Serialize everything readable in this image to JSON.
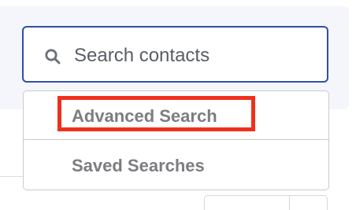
{
  "search": {
    "placeholder": "Search contacts",
    "value": ""
  },
  "dropdown": {
    "items": [
      {
        "label": "Advanced Search",
        "highlighted": true
      },
      {
        "label": "Saved Searches",
        "highlighted": false
      }
    ]
  },
  "colors": {
    "panel_background": "#f5f6fb",
    "search_border": "#2f4fa8",
    "menu_text": "#7c7d81",
    "highlight_outline": "#f0301c"
  },
  "icons": {
    "search": "search-icon"
  }
}
